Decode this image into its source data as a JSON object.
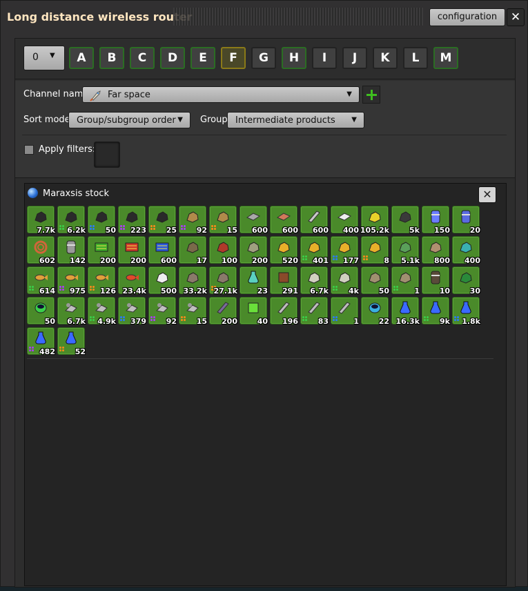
{
  "window": {
    "title": "Long distance wireless router",
    "config_label": "configuration",
    "close_label": "✕"
  },
  "letters": {
    "number_value": "0",
    "items": [
      "A",
      "B",
      "C",
      "D",
      "E",
      "F",
      "G",
      "H",
      "I",
      "J",
      "K",
      "L",
      "M"
    ],
    "selected": "F",
    "dim": [
      "G",
      "I",
      "J",
      "K",
      "L"
    ]
  },
  "settings": {
    "channel_label": "Channel name",
    "channel_value": "Far space",
    "sort_label": "Sort mode",
    "sort_value": "Group/subgroup order",
    "group_label": "Group",
    "group_value": "Intermediate products",
    "apply_label": "Apply filters:"
  },
  "stock": {
    "title": "Maraxsis stock",
    "close_label": "✕",
    "items": [
      {
        "icon": "circuit-parts-icon",
        "count": "7.7k",
        "color": "#2a2a2a",
        "quality": ""
      },
      {
        "icon": "circuit-parts-icon",
        "count": "6.2k",
        "color": "#2a2a2a",
        "quality": "uncommon"
      },
      {
        "icon": "circuit-parts-icon",
        "count": "50",
        "color": "#2a2a2a",
        "quality": "rare"
      },
      {
        "icon": "circuit-parts-icon",
        "count": "223",
        "color": "#2a2a2a",
        "quality": "epic"
      },
      {
        "icon": "circuit-parts-icon",
        "count": "25",
        "color": "#2a2a2a",
        "quality": "legendary"
      },
      {
        "icon": "ore-pile-icon",
        "count": "92",
        "color": "#b08a4a",
        "quality": "epic"
      },
      {
        "icon": "ore-pile-icon",
        "count": "15",
        "color": "#b08a4a",
        "quality": "legendary"
      },
      {
        "icon": "iron-plate-icon",
        "count": "600",
        "color": "#a9a9a9",
        "quality": ""
      },
      {
        "icon": "copper-plate-icon",
        "count": "600",
        "color": "#d07a5a",
        "quality": ""
      },
      {
        "icon": "steel-beam-icon",
        "count": "600",
        "color": "#c8c8c8",
        "quality": ""
      },
      {
        "icon": "plastic-bar-icon",
        "count": "400",
        "color": "#eeeeee",
        "quality": ""
      },
      {
        "icon": "sulfur-icon",
        "count": "105.2k",
        "color": "#e8d22a",
        "quality": ""
      },
      {
        "icon": "solid-fuel-icon",
        "count": "5k",
        "color": "#3a3a3a",
        "quality": ""
      },
      {
        "icon": "barrel-blue-icon",
        "count": "150",
        "color": "#6a7cff",
        "quality": ""
      },
      {
        "icon": "barrel-blue-icon",
        "count": "20",
        "color": "#5a6ae0",
        "quality": ""
      },
      {
        "icon": "copper-cable-icon",
        "count": "602",
        "color": "#d0663a",
        "quality": ""
      },
      {
        "icon": "barrel-icon",
        "count": "142",
        "color": "#9a9a9a",
        "quality": ""
      },
      {
        "icon": "green-circuit-icon",
        "count": "200",
        "color": "#3fae2a",
        "quality": ""
      },
      {
        "icon": "red-circuit-icon",
        "count": "200",
        "color": "#d03a2a",
        "quality": ""
      },
      {
        "icon": "blue-circuit-icon",
        "count": "600",
        "color": "#2a5ae0",
        "quality": ""
      },
      {
        "icon": "engine-icon",
        "count": "17",
        "color": "#7a6a4a",
        "quality": ""
      },
      {
        "icon": "electric-engine-icon",
        "count": "100",
        "color": "#b03a2a",
        "quality": ""
      },
      {
        "icon": "flying-robot-frame-icon",
        "count": "200",
        "color": "#a0a080",
        "quality": ""
      },
      {
        "icon": "rocket-fuel-icon",
        "count": "520",
        "color": "#e8b02a",
        "quality": ""
      },
      {
        "icon": "rocket-fuel-icon",
        "count": "401",
        "color": "#e8b02a",
        "quality": "uncommon"
      },
      {
        "icon": "rocket-fuel-icon",
        "count": "177",
        "color": "#e8b02a",
        "quality": "rare"
      },
      {
        "icon": "rocket-fuel-icon",
        "count": "8",
        "color": "#e8b02a",
        "quality": "legendary"
      },
      {
        "icon": "pipe-cluster-icon",
        "count": "5.1k",
        "color": "#5aa05a",
        "quality": ""
      },
      {
        "icon": "sand-sack-icon",
        "count": "800",
        "color": "#b09070",
        "quality": ""
      },
      {
        "icon": "glass-icon",
        "count": "400",
        "color": "#3ab0b0",
        "quality": ""
      },
      {
        "icon": "fish-icon",
        "count": "614",
        "color": "#e0a03a",
        "quality": "uncommon"
      },
      {
        "icon": "fish-icon",
        "count": "975",
        "color": "#e0a03a",
        "quality": "epic"
      },
      {
        "icon": "fish-icon",
        "count": "126",
        "color": "#e0a03a",
        "quality": "legendary"
      },
      {
        "icon": "koi-fish-icon",
        "count": "23.4k",
        "color": "#e04a2a",
        "quality": ""
      },
      {
        "icon": "salt-icon",
        "count": "500",
        "color": "#eeeeee",
        "quality": ""
      },
      {
        "icon": "shell-icon",
        "count": "33.2k",
        "color": "#8a7a6a",
        "quality": ""
      },
      {
        "icon": "shell-icon",
        "count": "27.1k",
        "color": "#8a7a6a",
        "quality": "legendary"
      },
      {
        "icon": "flask-icon",
        "count": "23",
        "color": "#5ad0c0",
        "quality": ""
      },
      {
        "icon": "wood-block-icon",
        "count": "291",
        "color": "#8a4a2a",
        "quality": ""
      },
      {
        "icon": "coral-icon",
        "count": "6.7k",
        "color": "#d0d0c0",
        "quality": ""
      },
      {
        "icon": "coral-icon",
        "count": "4k",
        "color": "#d0d0c0",
        "quality": "uncommon"
      },
      {
        "icon": "basket-icon",
        "count": "50",
        "color": "#a09070",
        "quality": ""
      },
      {
        "icon": "basket-icon",
        "count": "1",
        "color": "#a09070",
        "quality": "uncommon"
      },
      {
        "icon": "barrel-stack-icon",
        "count": "10",
        "color": "#5a4a3a",
        "quality": ""
      },
      {
        "icon": "green-ore-icon",
        "count": "30",
        "color": "#2a8a3a",
        "quality": ""
      },
      {
        "icon": "green-container-icon",
        "count": "50",
        "color": "#3ad04a",
        "quality": ""
      },
      {
        "icon": "drone-icon",
        "count": "6.7k",
        "color": "#c0c0c0",
        "quality": ""
      },
      {
        "icon": "drone-icon",
        "count": "4.9k",
        "color": "#c0c0c0",
        "quality": "uncommon"
      },
      {
        "icon": "drone-icon",
        "count": "379",
        "color": "#c0c0c0",
        "quality": "rare"
      },
      {
        "icon": "drone-icon",
        "count": "92",
        "color": "#c0c0c0",
        "quality": "epic"
      },
      {
        "icon": "drone-icon",
        "count": "15",
        "color": "#c0c0c0",
        "quality": "legendary"
      },
      {
        "icon": "rod-icon",
        "count": "200",
        "color": "#7a6a9a",
        "quality": ""
      },
      {
        "icon": "green-cube-icon",
        "count": "40",
        "color": "#6ae03a",
        "quality": ""
      },
      {
        "icon": "mesh-icon",
        "count": "196",
        "color": "#bdbdbd",
        "quality": ""
      },
      {
        "icon": "mesh-icon",
        "count": "83",
        "color": "#bdbdbd",
        "quality": "uncommon"
      },
      {
        "icon": "mesh-icon",
        "count": "1",
        "color": "#bdbdbd",
        "quality": "rare"
      },
      {
        "icon": "cyan-ring-icon",
        "count": "22",
        "color": "#3ab0e0",
        "quality": ""
      },
      {
        "icon": "blue-potion-icon",
        "count": "16.3k",
        "color": "#3a6aff",
        "quality": ""
      },
      {
        "icon": "blue-potion-icon",
        "count": "9k",
        "color": "#3a6aff",
        "quality": "uncommon"
      },
      {
        "icon": "blue-potion-icon",
        "count": "1.8k",
        "color": "#3a6aff",
        "quality": "rare"
      },
      {
        "icon": "blue-potion-icon",
        "count": "482",
        "color": "#3a6aff",
        "quality": "epic"
      },
      {
        "icon": "blue-potion-icon",
        "count": "52",
        "color": "#3a6aff",
        "quality": "legendary"
      }
    ]
  },
  "quality_colors": {
    "uncommon": "#3ad04a",
    "rare": "#2a7aff",
    "epic": "#b03aff",
    "legendary": "#ff8a1a"
  }
}
